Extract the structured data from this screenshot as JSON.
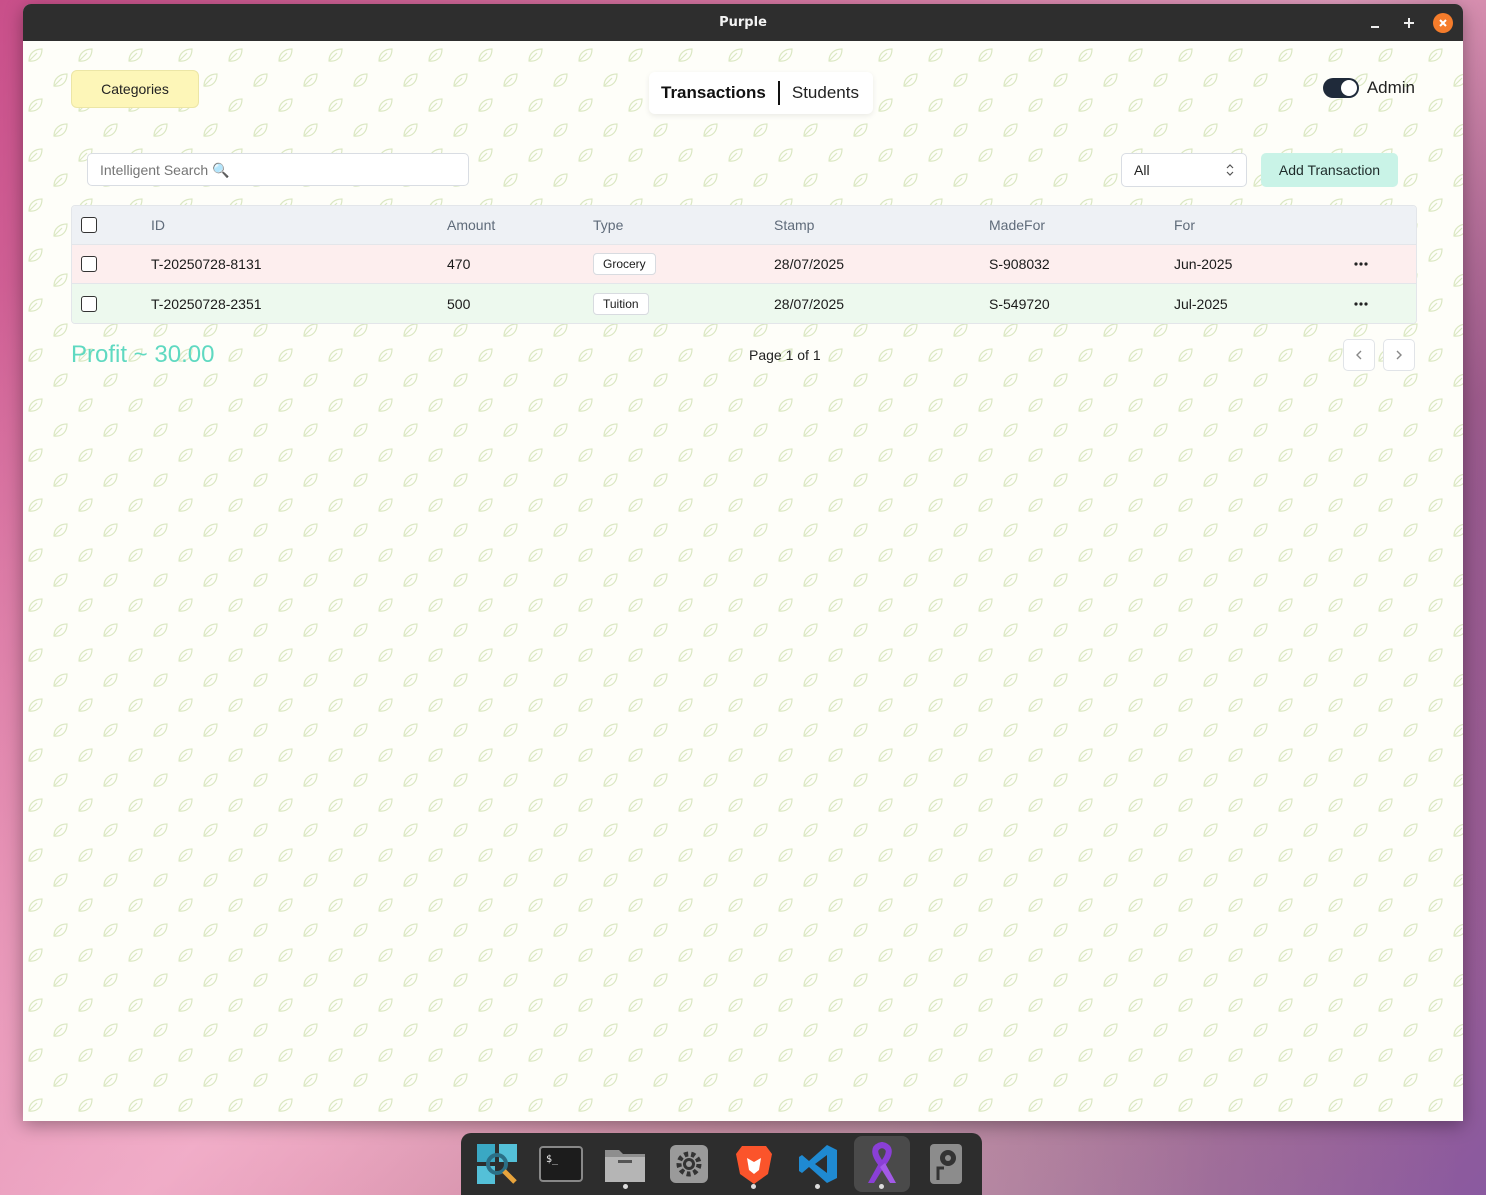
{
  "window": {
    "title": "Purple"
  },
  "header": {
    "categories_label": "Categories",
    "tabs": [
      {
        "label": "Transactions",
        "active": true
      },
      {
        "label": "Students",
        "active": false
      }
    ],
    "admin_label": "Admin",
    "admin_enabled": true
  },
  "toolbar": {
    "search_placeholder": "Intelligent Search 🔍",
    "filter_value": "All",
    "add_label": "Add Transaction"
  },
  "table": {
    "columns": [
      "ID",
      "Amount",
      "Type",
      "Stamp",
      "MadeFor",
      "For"
    ],
    "rows": [
      {
        "id": "T-20250728-8131",
        "amount": "470",
        "type": "Grocery",
        "stamp": "28/07/2025",
        "madefor": "S-908032",
        "for": "Jun-2025"
      },
      {
        "id": "T-20250728-2351",
        "amount": "500",
        "type": "Tuition",
        "stamp": "28/07/2025",
        "madefor": "S-549720",
        "for": "Jul-2025"
      }
    ]
  },
  "footer": {
    "profit": "Profit ~ 30.00",
    "page_info": "Page 1 of 1"
  },
  "colors": {
    "profit": "#5fd9c1",
    "add_button": "#c9f3e7",
    "categories_button": "#fdf6b8",
    "row_expense": "#fdeeee",
    "row_income": "#edf9ee"
  },
  "dock": {
    "items": [
      {
        "icon": "search-magnifier-icon",
        "running": false
      },
      {
        "icon": "terminal-icon",
        "running": false
      },
      {
        "icon": "files-folder-icon",
        "running": true
      },
      {
        "icon": "settings-gear-icon",
        "running": false
      },
      {
        "icon": "brave-lion-icon",
        "running": true
      },
      {
        "icon": "vscode-icon",
        "running": true
      },
      {
        "icon": "purple-ribbon-icon",
        "running": true,
        "active": true
      },
      {
        "icon": "disk-drive-icon",
        "running": false
      }
    ]
  }
}
